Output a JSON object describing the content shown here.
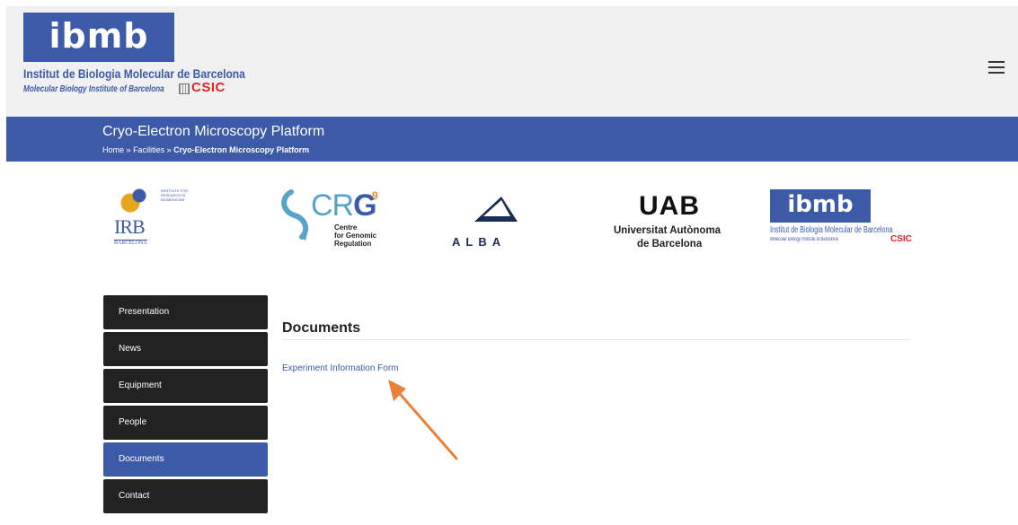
{
  "header": {
    "logo_text": "ibmb",
    "institute_name": "Institut de Biologia Molecular de Barcelona",
    "institute_subtitle": "Molecular Biology Institute of Barcelona",
    "csic_label": "CSIC",
    "menu_icon": "hamburger-menu-icon"
  },
  "banner": {
    "title": "Cryo-Electron Microscopy Platform",
    "breadcrumb": {
      "home": "Home",
      "separator": "»",
      "facilities": "Facilities",
      "current": "Cryo-Electron Microscopy Platform"
    }
  },
  "partners": {
    "irb": {
      "tagline": "INSTITUTE FOR RESEARCH IN BIOMEDICINE",
      "letters": "IRB",
      "city": "BARCELONA"
    },
    "crg": {
      "letters_light": "CR",
      "letters_dark": "G",
      "superscript": "9",
      "line1": "Centre",
      "line2": "for Genomic",
      "line3": "Regulation"
    },
    "alba": {
      "name": "ALBA"
    },
    "uab": {
      "mark": "UAB",
      "line1": "Universitat Autònoma",
      "line2": "de Barcelona"
    },
    "ibmb": {
      "logo_text": "ibmb",
      "name": "Institut de Biologia Molecular de Barcelona",
      "subtitle": "Molecular Biology Institute of Barcelona",
      "csic": "CSIC"
    }
  },
  "sidebar": {
    "items": [
      {
        "label": "Presentation",
        "active": false
      },
      {
        "label": "News",
        "active": false
      },
      {
        "label": "Equipment",
        "active": false
      },
      {
        "label": "People",
        "active": false
      },
      {
        "label": "Documents",
        "active": true
      },
      {
        "label": "Contact",
        "active": false
      }
    ]
  },
  "content": {
    "section_title": "Documents",
    "link_label": "Experiment Information Form"
  },
  "colors": {
    "brand_blue": "#3d5aa9",
    "nav_dark": "#222222",
    "annotation_arrow": "#e8823a",
    "csic_red": "#e4222a"
  }
}
